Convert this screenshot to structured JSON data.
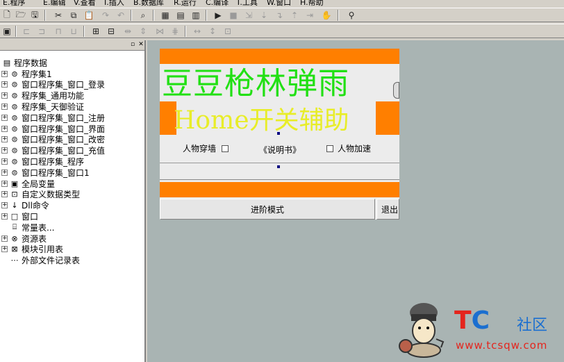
{
  "menu": {
    "items": [
      "E.程序",
      "E.编辑",
      "V.查看",
      "I.插入",
      "B.数据库",
      "R.运行",
      "C.编译",
      "T.工具",
      "W.窗口",
      "H.帮助"
    ]
  },
  "tree": {
    "root": "程序数据",
    "items": [
      {
        "label": "程序集1",
        "icon": "module-icon"
      },
      {
        "label": "窗口程序集_窗口_登录",
        "icon": "module-icon"
      },
      {
        "label": "程序集_通用功能",
        "icon": "module-icon"
      },
      {
        "label": "程序集_天御验证",
        "icon": "module-icon"
      },
      {
        "label": "窗口程序集_窗口_注册",
        "icon": "module-icon"
      },
      {
        "label": "窗口程序集_窗口_界面",
        "icon": "module-icon"
      },
      {
        "label": "窗口程序集_窗口_改密",
        "icon": "module-icon"
      },
      {
        "label": "窗口程序集_窗口_充值",
        "icon": "module-icon"
      },
      {
        "label": "窗口程序集_程序",
        "icon": "module-icon"
      },
      {
        "label": "窗口程序集_窗口1",
        "icon": "module-icon"
      },
      {
        "label": "全局变量",
        "icon": "variable-icon"
      },
      {
        "label": "自定义数据类型",
        "icon": "datatype-icon"
      },
      {
        "label": "Dll命令",
        "icon": "dll-icon"
      },
      {
        "label": "窗口",
        "icon": "window-icon"
      },
      {
        "label": "常量表...",
        "icon": "constant-icon"
      },
      {
        "label": "资源表",
        "icon": "resource-icon"
      },
      {
        "label": "模块引用表",
        "icon": "module-ref-icon"
      },
      {
        "label": "外部文件记录表",
        "icon": "file-record-icon"
      }
    ]
  },
  "form": {
    "title_text": "豆豆枪林弹雨",
    "subtitle_text": "Home开关辅助",
    "checkbox1": "人物穿墙",
    "manual_label": "《说明书》",
    "checkbox2": "人物加速",
    "advanced_button": "进阶模式",
    "exit_button": "退出"
  },
  "watermark": {
    "brand_t": "T",
    "brand_c": "C",
    "brand_suffix": "社区",
    "url": "www.tcsqw.com"
  },
  "colors": {
    "accent_orange": "#ff7f00",
    "title_green": "#22e014",
    "subtitle_yellow": "#e8ed28",
    "designer_bg": "#a9b4b3"
  }
}
